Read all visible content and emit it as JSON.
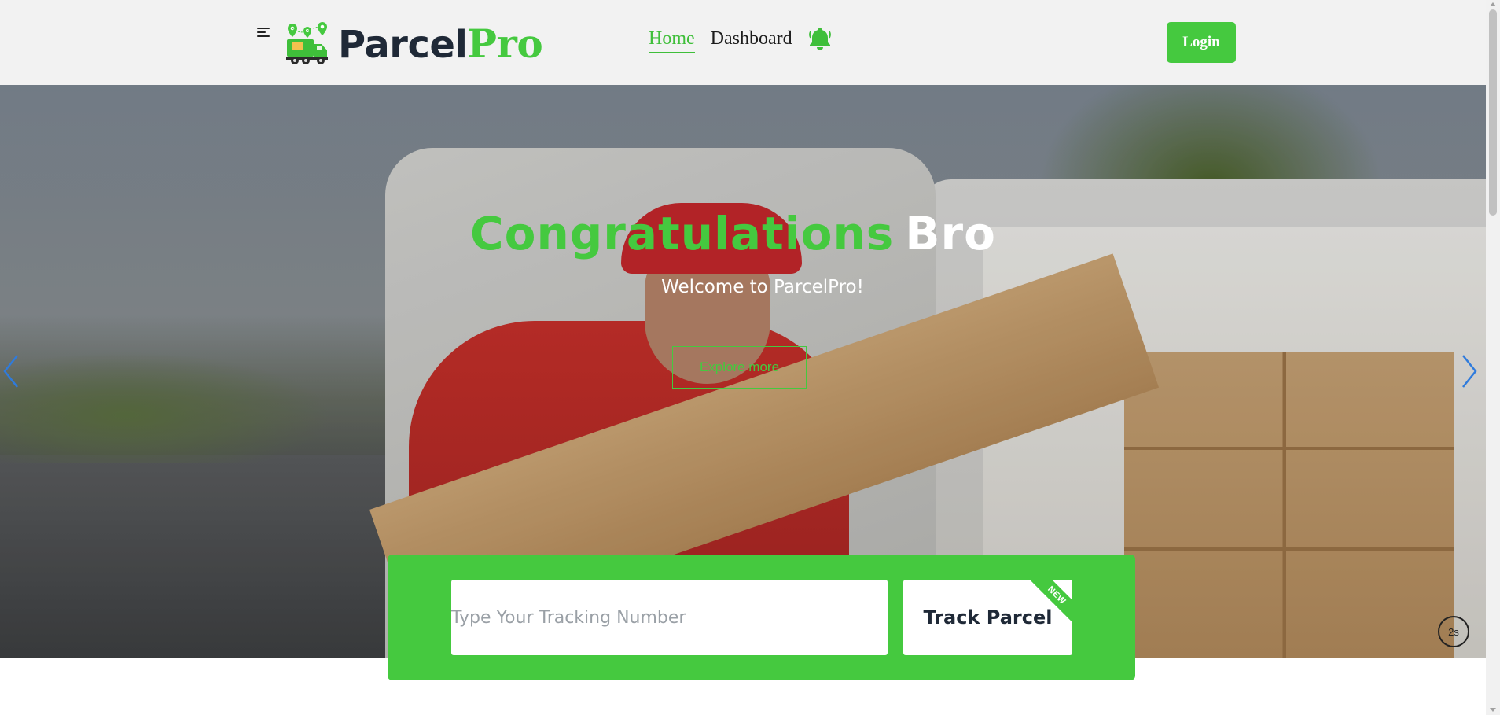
{
  "brand": {
    "name_part1": "Parcel",
    "name_part2": "Pro",
    "color_primary": "#45c93f",
    "color_dark": "#1f2937"
  },
  "header": {
    "menu_icon": "hamburger-menu-icon",
    "logo_icon": "delivery-truck-icon",
    "nav": [
      {
        "label": "Home",
        "active": true
      },
      {
        "label": "Dashboard",
        "active": false
      }
    ],
    "notification_icon": "bell-icon",
    "login_label": "Login"
  },
  "hero": {
    "title_green": "Congratulations",
    "title_white": "Bro",
    "subtitle": "Welcome to ParcelPro!",
    "explore_label": "Explore more",
    "prev_icon": "chevron-left-icon",
    "next_icon": "chevron-right-icon",
    "timer_label": "2s"
  },
  "tracker": {
    "input_placeholder": "Type Your Tracking Number",
    "input_value": "",
    "button_label": "Track Parcel",
    "ribbon_label": "NEW"
  }
}
